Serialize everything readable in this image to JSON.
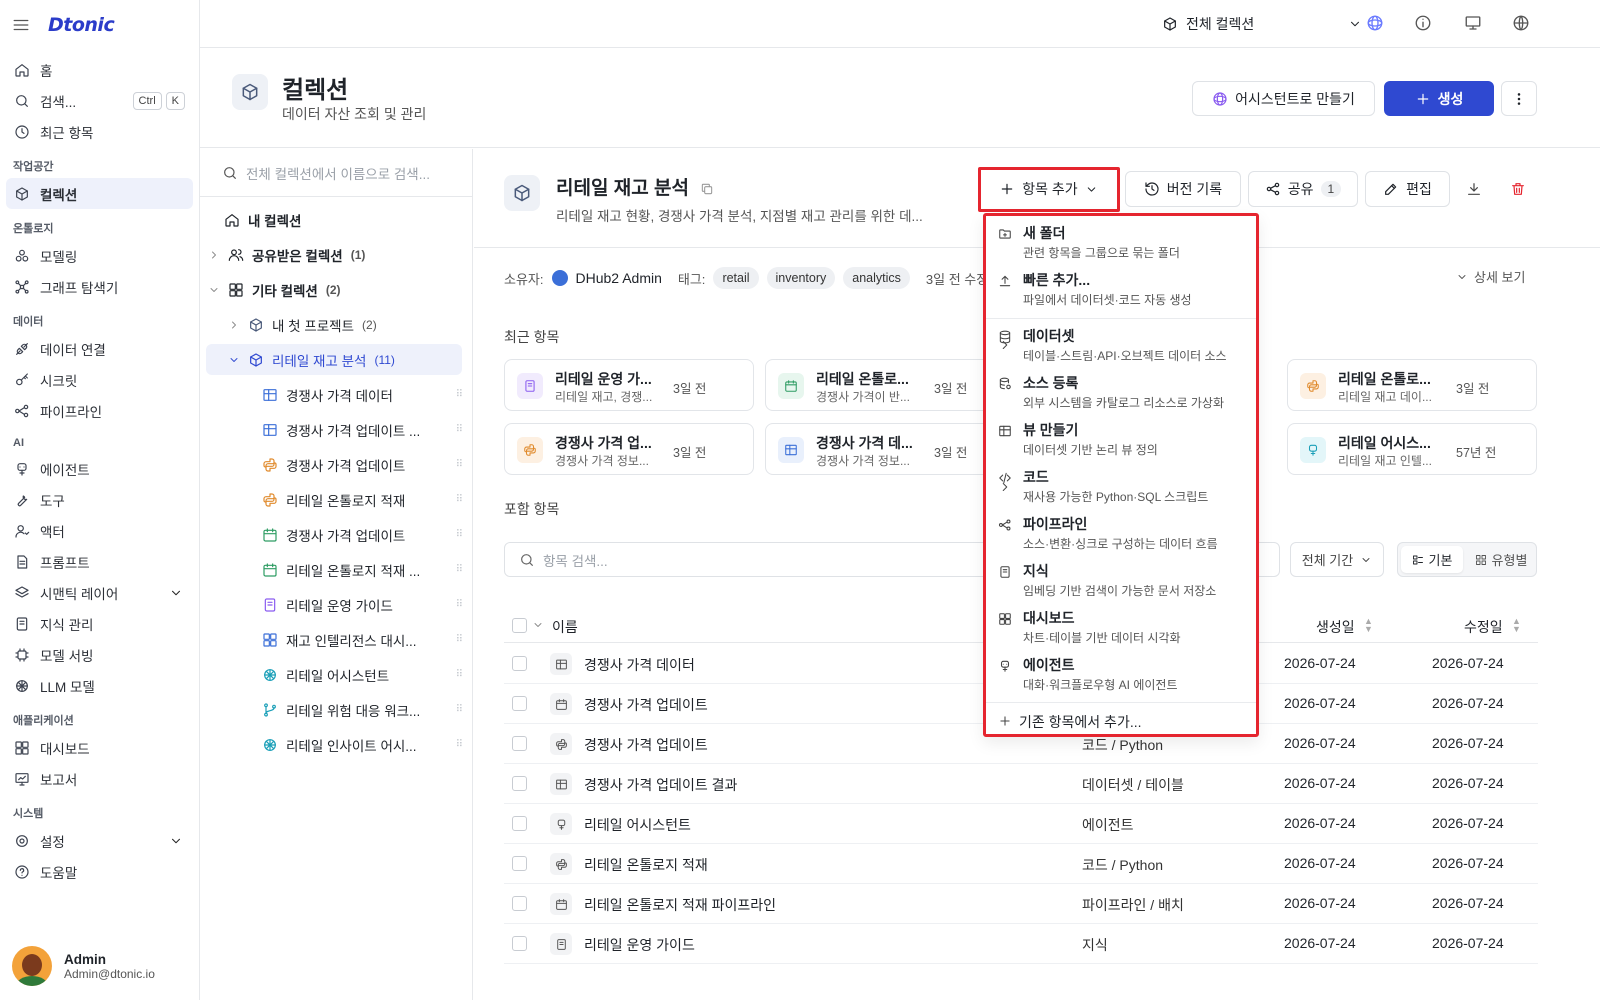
{
  "app": {
    "logo": "Dtonic"
  },
  "sidebar": {
    "home": "홈",
    "search": "검색...",
    "search_kbd1": "Ctrl",
    "search_kbd2": "K",
    "recent": "최근 항목",
    "sections": {
      "workspace": "작업공간",
      "ontology": "온톨로지",
      "data": "데이터",
      "ai": "AI",
      "apps": "애플리케이션",
      "system": "시스템"
    },
    "items": {
      "collection": "컬렉션",
      "modeling": "모델링",
      "graph": "그래프 탐색기",
      "connect": "데이터 연결",
      "secret": "시크릿",
      "pipeline": "파이프라인",
      "agent": "에이전트",
      "tool": "도구",
      "actor": "액터",
      "prompt": "프롬프트",
      "semantic": "시맨틱 레이어",
      "knowledge": "지식 관리",
      "serving": "모델 서빙",
      "llm": "LLM 모델",
      "dashboard": "대시보드",
      "report": "보고서",
      "settings": "설정",
      "help": "도움말"
    },
    "user": {
      "name": "Admin",
      "email": "Admin@dtonic.io"
    }
  },
  "topbar": {
    "collection_select": "전체 컬렉션"
  },
  "header": {
    "title": "컬렉션",
    "subtitle": "데이터 자산 조회 및 관리",
    "assistant_btn": "어시스턴트로 만들기",
    "create_btn": "생성"
  },
  "tree": {
    "search_placeholder": "전체 컬렉션에서 이름으로 검색...",
    "my_collection": "내 컬렉션",
    "shared": "공유받은 컬렉션",
    "shared_count": "(1)",
    "other": "기타 컬렉션",
    "other_count": "(2)",
    "first_project": "내 첫 프로젝트",
    "first_project_count": "(2)",
    "retail": "리테일 재고 분석",
    "retail_count": "(11)",
    "children": [
      "경쟁사 가격 데이터",
      "경쟁사 가격 업데이트 ...",
      "경쟁사 가격 업데이트",
      "리테일 온톨로지 적재",
      "경쟁사 가격 업데이트",
      "리테일 온톨로지 적재 ...",
      "리테일 운영 가이드",
      "재고 인텔리전스 대시...",
      "리테일 어시스턴트",
      "리테일 위험 대응 워크...",
      "리테일 인사이트 어시..."
    ]
  },
  "detail": {
    "title": "리테일 재고 분석",
    "desc": "리테일 재고 현황, 경쟁사 가격 분석, 지점별 재고 관리를 위한 데...",
    "add_item": "항목 추가",
    "history": "버전 기록",
    "share": "공유",
    "share_count": "1",
    "edit": "편집",
    "owner_label": "소유자:",
    "owner": "DHub2 Admin",
    "tag_label": "태그:",
    "tags": [
      "retail",
      "inventory",
      "analytics"
    ],
    "modified": "3일 전 수정",
    "detail_view": "상세 보기",
    "recent_title": "최근 항목",
    "included_title": "포함 항목",
    "item_search_placeholder": "항목 검색...",
    "period": "전체 기간",
    "view_basic": "기본",
    "view_type": "유형별"
  },
  "recent_cards": [
    {
      "title": "리테일 운영 가...",
      "sub": "리테일 재고, 경쟁...",
      "date": "3일 전"
    },
    {
      "title": "리테일 온톨로...",
      "sub": "경쟁사 가격이 반...",
      "date": "3일 전"
    },
    {
      "title": "리테일 온톨로...",
      "sub": "리테일 재고 데이...",
      "date": "3일 전"
    },
    {
      "title": "경쟁사 가격 업...",
      "sub": "경쟁사 가격 정보...",
      "date": "3일 전"
    },
    {
      "title": "경쟁사 가격 데...",
      "sub": "경쟁사 가격 정보...",
      "date": "3일 전"
    },
    {
      "title": "리테일 어시스...",
      "sub": "리테일 재고 인텔...",
      "date": "57년 전"
    }
  ],
  "table": {
    "col_name": "이름",
    "col_created": "생성일",
    "col_modified": "수정일",
    "rows": [
      {
        "name": "경쟁사 가격 데이터",
        "type": "",
        "created": "2026-07-24",
        "modified": "2026-07-24"
      },
      {
        "name": "경쟁사 가격 업데이트",
        "type": "",
        "created": "2026-07-24",
        "modified": "2026-07-24"
      },
      {
        "name": "경쟁사 가격 업데이트",
        "type": "코드 / Python",
        "created": "2026-07-24",
        "modified": "2026-07-24"
      },
      {
        "name": "경쟁사 가격 업데이트 결과",
        "type": "데이터셋 / 테이블",
        "created": "2026-07-24",
        "modified": "2026-07-24"
      },
      {
        "name": "리테일 어시스턴트",
        "type": "에이전트",
        "created": "2026-07-24",
        "modified": "2026-07-24"
      },
      {
        "name": "리테일 온톨로지 적재",
        "type": "코드 / Python",
        "created": "2026-07-24",
        "modified": "2026-07-24"
      },
      {
        "name": "리테일 온톨로지 적재 파이프라인",
        "type": "파이프라인 / 배치",
        "created": "2026-07-24",
        "modified": "2026-07-24"
      },
      {
        "name": "리테일 운영 가이드",
        "type": "지식",
        "created": "2026-07-24",
        "modified": "2026-07-24"
      }
    ]
  },
  "dropdown": {
    "items": [
      {
        "title": "새 폴더",
        "sub": "관련 항목을 그룹으로 묶는 폴더"
      },
      {
        "title": "빠른 추가...",
        "sub": "파일에서 데이터셋·코드 자동 생성"
      },
      {
        "title": "데이터셋",
        "sub": "테이블·스트림·API·오브젝트 데이터 소스"
      },
      {
        "title": "소스 등록",
        "sub": "외부 시스템을 카탈로그 리소스로 가상화"
      },
      {
        "title": "뷰 만들기",
        "sub": "데이터셋 기반 논리 뷰 정의"
      },
      {
        "title": "코드",
        "sub": "재사용 가능한 Python·SQL 스크립트"
      },
      {
        "title": "파이프라인",
        "sub": "소스·변환·싱크로 구성하는 데이터 흐름"
      },
      {
        "title": "지식",
        "sub": "임베딩 기반 검색이 가능한 문서 저장소"
      },
      {
        "title": "대시보드",
        "sub": "차트·테이블 기반 데이터 시각화"
      },
      {
        "title": "에이전트",
        "sub": "대화·워크플로우형 AI 에이전트"
      }
    ],
    "existing": "기존 항목에서 추가..."
  },
  "colors": {
    "primary": "#2f49d1",
    "highlight": "#e5252f",
    "active_bg": "#eef1fb"
  }
}
